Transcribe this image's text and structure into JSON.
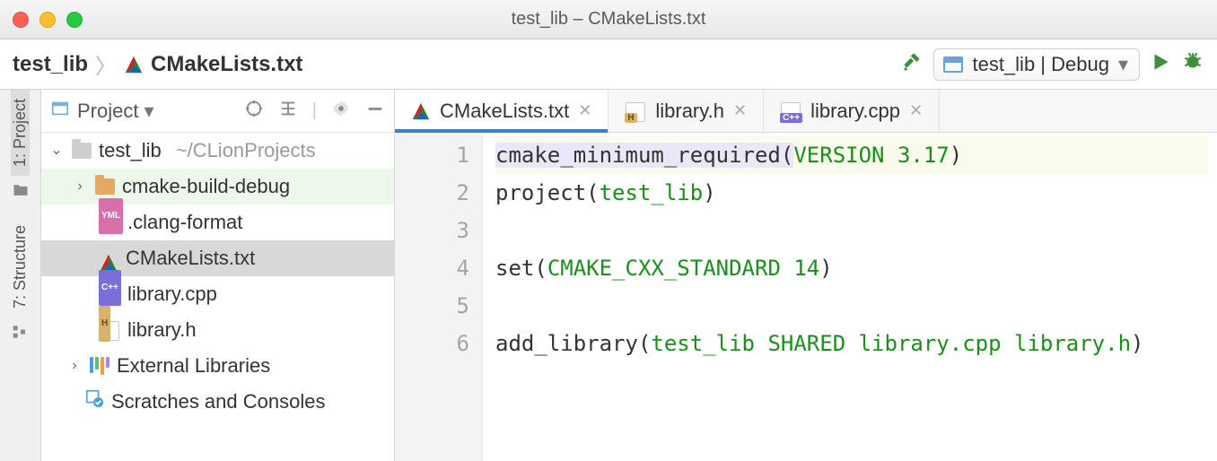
{
  "window": {
    "title": "test_lib – CMakeLists.txt"
  },
  "breadcrumb": {
    "project": "test_lib",
    "file": "CMakeLists.txt"
  },
  "toolbar": {
    "run_config": "test_lib | Debug"
  },
  "left_tabs": {
    "project": "1: Project",
    "structure": "7: Structure"
  },
  "sidepanel": {
    "label": "Project"
  },
  "tree": {
    "root": {
      "name": "test_lib",
      "path": "~/CLionProjects"
    },
    "items": [
      {
        "name": "cmake-build-debug"
      },
      {
        "name": ".clang-format"
      },
      {
        "name": "CMakeLists.txt"
      },
      {
        "name": "library.cpp"
      },
      {
        "name": "library.h"
      }
    ],
    "ext_libs": "External Libraries",
    "scratches": "Scratches and Consoles"
  },
  "tabs": [
    {
      "label": "CMakeLists.txt"
    },
    {
      "label": "library.h"
    },
    {
      "label": "library.cpp"
    }
  ],
  "code": {
    "lines": [
      "1",
      "2",
      "3",
      "4",
      "5",
      "6"
    ],
    "l1_fn": "cmake_minimum_required",
    "l1_arg": "VERSION 3.17",
    "l2_fn": "project",
    "l2_arg": "test_lib",
    "l4_fn": "set",
    "l4_arg": "CMAKE_CXX_STANDARD 14",
    "l6_fn": "add_library",
    "l6_arg": "test_lib SHARED library.cpp library.h"
  }
}
